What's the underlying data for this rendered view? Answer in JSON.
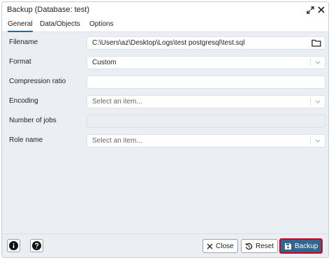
{
  "window": {
    "title": "Backup (Database: test)"
  },
  "tabs": [
    {
      "label": "General",
      "active": true
    },
    {
      "label": "Data/Objects",
      "active": false
    },
    {
      "label": "Options",
      "active": false
    }
  ],
  "form": {
    "filename": {
      "label": "Filename",
      "value": "C:\\Users\\az\\Desktop\\Logs\\test postgresql\\test.sql"
    },
    "format": {
      "label": "Format",
      "value": "Custom"
    },
    "compression": {
      "label": "Compression ratio",
      "value": ""
    },
    "encoding": {
      "label": "Encoding",
      "placeholder": "Select an item..."
    },
    "jobs": {
      "label": "Number of jobs",
      "value": ""
    },
    "role": {
      "label": "Role name",
      "placeholder": "Select an item..."
    }
  },
  "footer": {
    "close_label": "Close",
    "reset_label": "Reset",
    "backup_label": "Backup"
  },
  "colors": {
    "primary": "#326690",
    "highlight_border": "#d0021b",
    "panel_bg": "#ebeef3"
  },
  "icons": [
    "expand-icon",
    "close-icon",
    "folder-icon",
    "chevron-down-icon",
    "info-icon",
    "help-icon",
    "x-icon",
    "reset-icon",
    "save-icon"
  ]
}
